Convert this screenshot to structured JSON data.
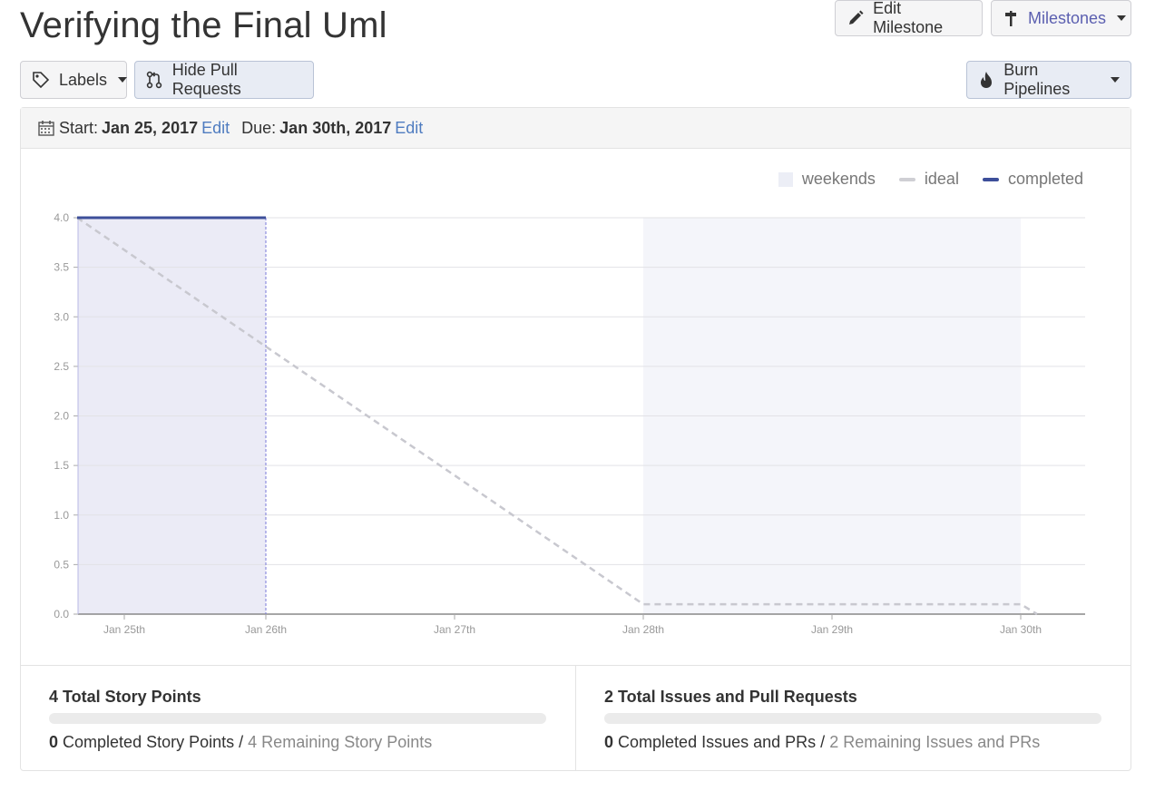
{
  "header": {
    "title": "Verifying the Final Uml",
    "edit_milestone_label": "Edit Milestone",
    "milestones_label": "Milestones"
  },
  "toolbar": {
    "labels_label": "Labels",
    "hide_prs_label": "Hide Pull Requests",
    "burn_pipelines_label": "Burn Pipelines"
  },
  "dates": {
    "start_label": "Start:",
    "start_value": "Jan 25, 2017",
    "start_edit": "Edit",
    "due_label": "Due:",
    "due_value": "Jan 30th, 2017",
    "due_edit": "Edit"
  },
  "legend": {
    "weekends": "weekends",
    "ideal": "ideal",
    "completed": "completed"
  },
  "chart_data": {
    "type": "line",
    "x_ticks": [
      "Jan 25th",
      "Jan 26th",
      "Jan 27th",
      "Jan 28th",
      "Jan 29th",
      "Jan 30th"
    ],
    "y_ticks": [
      "0.0",
      "0.5",
      "1.0",
      "1.5",
      "2.0",
      "2.5",
      "3.0",
      "3.5",
      "4.0"
    ],
    "ylim": [
      0,
      4
    ],
    "xlim": [
      "Jan 25, 2017",
      "Jan 30, 2017"
    ],
    "series": [
      {
        "name": "ideal",
        "points": [
          [
            "Jan 25, 2017",
            4.0
          ],
          [
            "Jan 28, 2017",
            0.1
          ],
          [
            "Jan 30, 2017",
            0.1
          ],
          [
            "Jan 30, 2017 +",
            0.0
          ]
        ]
      },
      {
        "name": "completed",
        "points": [
          [
            "Jan 25, 2017",
            4.0
          ],
          [
            "Jan 26, 2017",
            4.0
          ]
        ]
      }
    ],
    "weekends": [
      [
        "Jan 28, 2017",
        "Jan 30, 2017"
      ]
    ],
    "elapsed_until": "Jan 26, 2017",
    "colors": {
      "ideal": "#c8c8cf",
      "completed": "#3d4f9a",
      "weekend": "#f4f5fa",
      "elapsed": "#ebebf6",
      "grid": "#e2e2e6"
    }
  },
  "stats": {
    "points": {
      "total": "4 Total Story Points",
      "completed_num": "0",
      "completed_text": "Completed Story Points",
      "sep": "/",
      "remaining": "4 Remaining Story Points",
      "progress": 0
    },
    "issues": {
      "total": "2 Total Issues and Pull Requests",
      "completed_num": "0",
      "completed_text": "Completed Issues and PRs",
      "sep": "/",
      "remaining": "2 Remaining Issues and PRs",
      "progress": 0
    }
  }
}
